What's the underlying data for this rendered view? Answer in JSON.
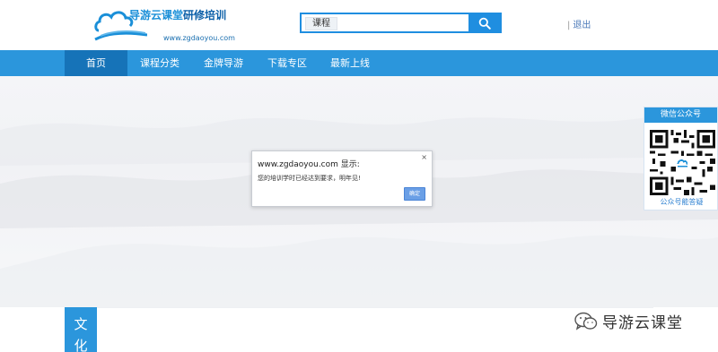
{
  "header": {
    "logo_title_main": "导游云课堂",
    "logo_title_accent": "研修培训",
    "logo_url": "www.zgdaoyou.com",
    "search_tag": "课程",
    "search_placeholder": "",
    "logout_sep": "|",
    "logout_label": "退出"
  },
  "nav": {
    "items": [
      {
        "label": "首页"
      },
      {
        "label": "课程分类"
      },
      {
        "label": "金牌导游"
      },
      {
        "label": "下载专区"
      },
      {
        "label": "最新上线"
      }
    ]
  },
  "dialog": {
    "title": "www.zgdaoyou.com 显示:",
    "close": "×",
    "message": "您的培训学时已经达到要求，明年见!",
    "ok_label": "确定"
  },
  "wechat": {
    "title": "微信公众号",
    "footer": "公众号能答疑"
  },
  "section": {
    "culture_label_1": "文",
    "culture_label_2": "化"
  },
  "watermark": {
    "text": "导游云课堂"
  },
  "colors": {
    "primary": "#2b96dc",
    "nav_active": "#1673b8",
    "dialog_button": "#6a9fe6"
  }
}
